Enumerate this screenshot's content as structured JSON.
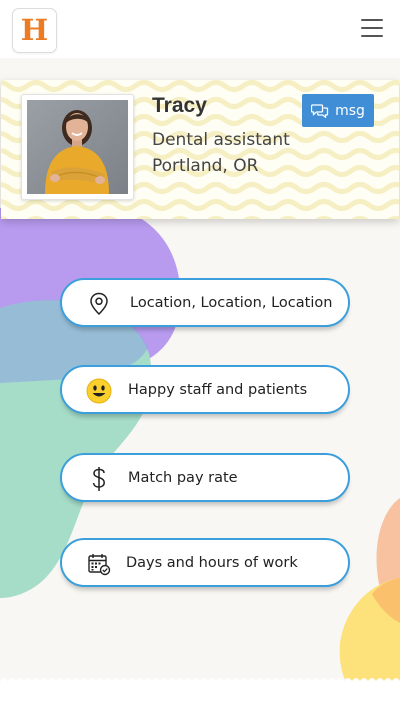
{
  "header": {
    "logo_letter": "H",
    "logo_color": "#ec7c24",
    "menu_icon": "hamburger-menu-icon"
  },
  "profile": {
    "name": "Tracy",
    "role": "Dental assistant",
    "location": "Portland, OR",
    "message_button": "msg",
    "message_icon": "chat-bubbles-icon"
  },
  "features": [
    {
      "label": "Location, Location, Location",
      "icon": "map-pin-icon"
    },
    {
      "label": "Happy staff and patients",
      "icon": "smiley-face-icon"
    },
    {
      "label": "Match pay rate",
      "icon": "dollar-sign-icon"
    },
    {
      "label": "Days and hours of work",
      "icon": "calendar-icon"
    }
  ],
  "colors": {
    "accent": "#3f8ed6",
    "pill_border": "#3c9fdc",
    "blob_purple": "#b89bef",
    "blob_teal": "#a8dfc9",
    "blob_peach": "#f7c6a6",
    "blob_yellow": "#fbe07a"
  }
}
